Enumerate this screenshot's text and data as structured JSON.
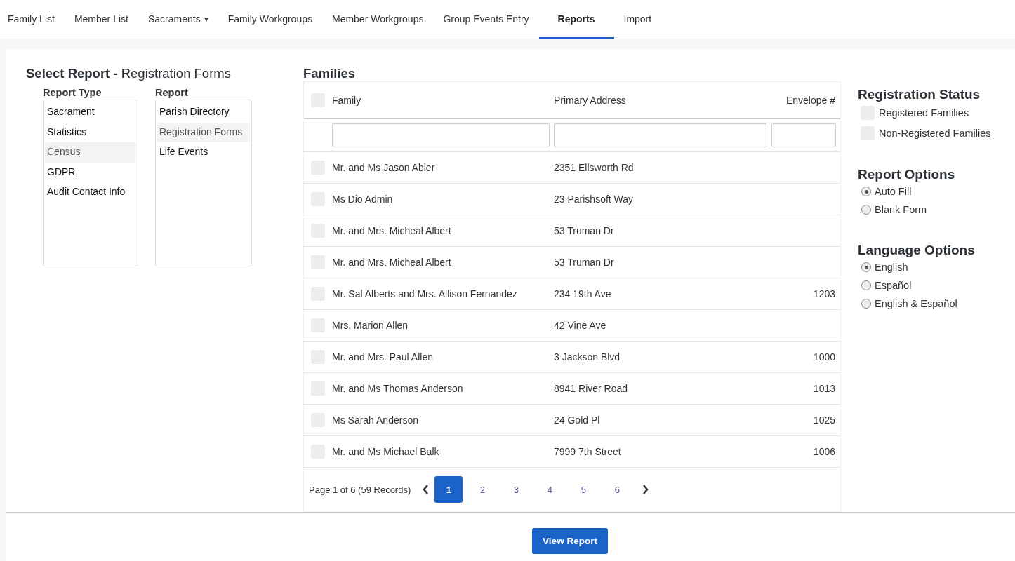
{
  "nav": [
    {
      "label": "Family List",
      "selected": false
    },
    {
      "label": "Member List",
      "selected": false
    },
    {
      "label": "Sacraments",
      "selected": false,
      "caret": "▾"
    },
    {
      "label": "Family Workgroups",
      "selected": false
    },
    {
      "label": "Member Workgroups",
      "selected": false
    },
    {
      "label": "Group Events Entry",
      "selected": false
    },
    {
      "label": "Reports",
      "selected": true
    },
    {
      "label": "Import",
      "selected": false
    }
  ],
  "select_report": {
    "title": "Select Report",
    "separator": "-",
    "subtitle": "Registration Forms",
    "report_type": {
      "label": "Report Type",
      "items": [
        {
          "label": "Sacrament",
          "selected": false
        },
        {
          "label": "Statistics",
          "selected": false
        },
        {
          "label": "Census",
          "selected": true
        },
        {
          "label": "GDPR",
          "selected": false
        },
        {
          "label": "Audit Contact Info",
          "selected": false
        }
      ]
    },
    "report": {
      "label": "Report",
      "items": [
        {
          "label": "Parish Directory",
          "selected": false
        },
        {
          "label": "Registration Forms",
          "selected": true
        },
        {
          "label": "Life Events",
          "selected": false
        }
      ]
    }
  },
  "families": {
    "title": "Families",
    "all_checked": false,
    "columns": [
      "Family",
      "Primary Address",
      "Envelope #"
    ],
    "rows": [
      {
        "checked": false,
        "family": "Mr. and Ms Jason Abler",
        "address": "2351 Ellsworth Rd"
      },
      {
        "checked": false,
        "family": "Ms Dio Admin",
        "address": "23 Parishsoft Way"
      },
      {
        "checked": false,
        "family": "Mr. and Mrs. Micheal Albert",
        "address": "53 Truman Dr"
      },
      {
        "checked": false,
        "family": "Mr. and Mrs. Micheal Albert",
        "address": "53 Truman Dr"
      },
      {
        "checked": false,
        "family": "Mr. Sal Alberts and Mrs. Allison Fernandez",
        "address": "234 19th Ave",
        "envelope": "1203"
      },
      {
        "checked": false,
        "family": "Mrs. Marion Allen",
        "address": "42 Vine Ave"
      },
      {
        "checked": false,
        "family": "Mr. and Mrs. Paul Allen",
        "address": "3 Jackson Blvd",
        "envelope": "1000"
      },
      {
        "checked": false,
        "family": "Mr. and Ms Thomas Anderson",
        "address": "8941 River Road",
        "envelope": "1013"
      },
      {
        "checked": false,
        "family": "Ms Sarah Anderson",
        "address": "24 Gold Pl",
        "envelope": "1025"
      },
      {
        "checked": false,
        "family": "Mr. and Ms Michael Balk",
        "address": "7999 7th Street",
        "envelope": "1006"
      }
    ],
    "pager": {
      "summary": "Page 1 of 6 (59 Records)",
      "pages": [
        {
          "label": "1",
          "selected": true
        },
        {
          "label": "2",
          "selected": false
        },
        {
          "label": "3",
          "selected": false
        },
        {
          "label": "4",
          "selected": false
        },
        {
          "label": "5",
          "selected": false
        },
        {
          "label": "6",
          "selected": false
        }
      ]
    }
  },
  "registration_status": {
    "title": "Registration Status",
    "options": [
      {
        "label": "Registered Families",
        "checked": false
      },
      {
        "label": "Non-Registered Families",
        "checked": false
      }
    ]
  },
  "report_options": {
    "title": "Report Options",
    "options": [
      {
        "label": "Auto Fill",
        "selected": true
      },
      {
        "label": "Blank Form",
        "selected": false
      }
    ]
  },
  "language_options": {
    "title": "Language Options",
    "options": [
      {
        "label": "English",
        "selected": true
      },
      {
        "label": "Español",
        "selected": false
      },
      {
        "label": "English & Español",
        "selected": false
      }
    ]
  },
  "view_button": "View Report"
}
